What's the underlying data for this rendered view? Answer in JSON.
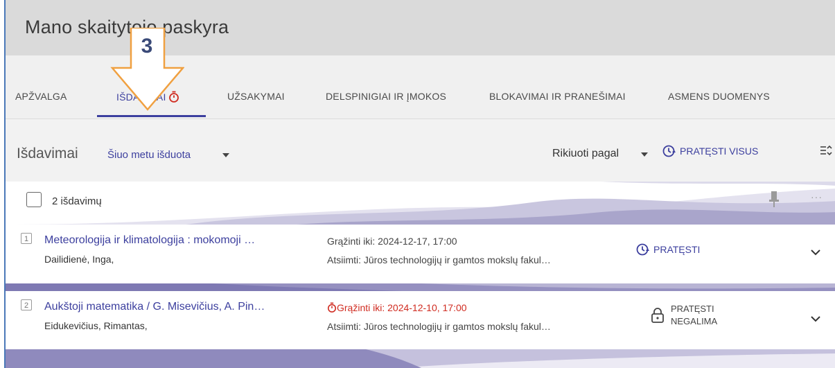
{
  "header": {
    "title": "Mano skaitytojo paskyra"
  },
  "tabs": [
    {
      "label": "APŽVALGA",
      "active": false
    },
    {
      "label": "IŠDAVIMAI",
      "active": true,
      "icon": "stopwatch-icon"
    },
    {
      "label": "UŽSAKYMAI",
      "active": false
    },
    {
      "label": "DELSPINIGIAI IR ĮMOKOS",
      "active": false
    },
    {
      "label": "BLOKAVIMAI IR PRANEŠIMAI",
      "active": false
    },
    {
      "label": "ASMENS DUOMENYS",
      "active": false
    }
  ],
  "callout": {
    "number": "3"
  },
  "toolbar": {
    "title": "Išdavimai",
    "filter_label": "Šiuo metu išduota",
    "sort_label": "Rikiuoti pagal",
    "renew_all_label": "PRATĘSTI VISUS"
  },
  "list": {
    "count_label": "2 išdavimų",
    "more_label": "···",
    "items": [
      {
        "index": "1",
        "title": "Meteorologija ir klimatologija : mokomoji …",
        "author": "Dailidienė, Inga,",
        "due": "Grąžinti iki: 2024-12-17, 17:00",
        "pickup": "Atsiimti: Jūros technologijų ir gamtos mokslų fakul…",
        "action": "PRATĘSTI",
        "overdue": false
      },
      {
        "index": "2",
        "title": "Aukštoji matematika / G. Misevičius, A. Pin…",
        "author": "Eidukevičius, Rimantas,",
        "due": "Grąžinti iki: 2024-12-10, 17:00",
        "pickup": "Atsiimti: Jūros technologijų ir gamtos mokslų fakul…",
        "action_line1": "PRATĘSTI",
        "action_line2": "NEGALIMA",
        "overdue": true
      }
    ]
  },
  "colors": {
    "accent": "#3c3f9e",
    "overdue": "#d02b20",
    "callout": "#f0a040",
    "banner": "#9a96c2"
  }
}
